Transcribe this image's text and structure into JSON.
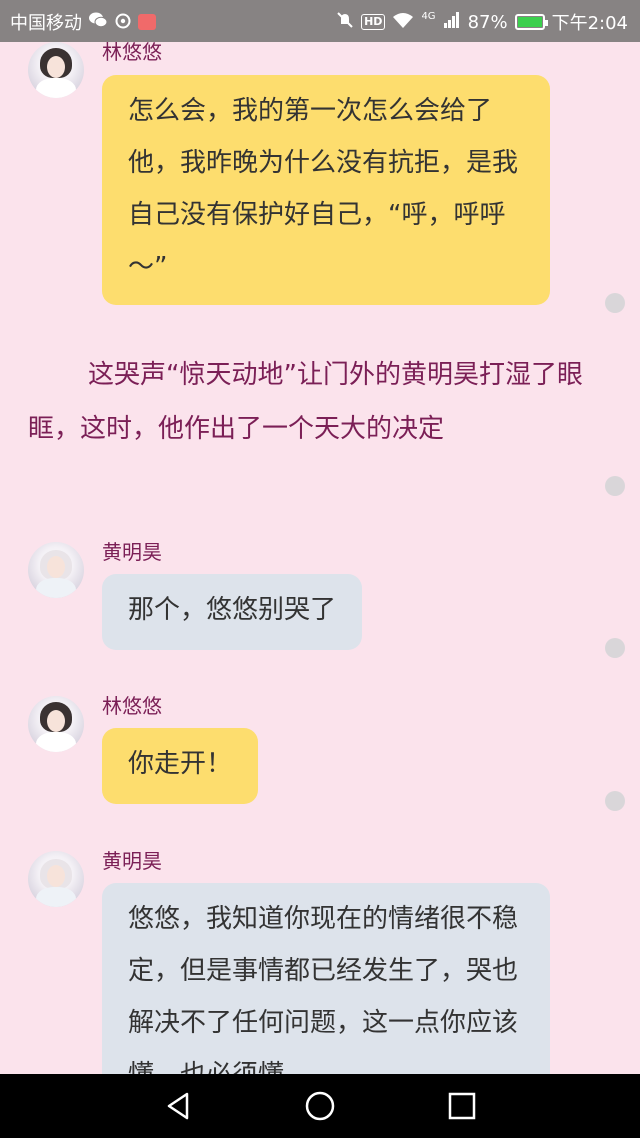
{
  "status_bar": {
    "carrier": "中国移动",
    "signal_type": "4G",
    "battery_percent": "87%",
    "time": "下午2:04",
    "hd_label": "HD",
    "icons": [
      "wechat-icon",
      "weibo-icon",
      "mail-icon",
      "mute-icon",
      "hd-icon",
      "wifi-icon",
      "signal-icon",
      "battery-icon"
    ]
  },
  "messages": [
    {
      "sender": "林悠悠",
      "type": "yellow",
      "text": "怎么会，我的第一次怎么会给了他，我昨晚为什么没有抗拒，是我自己没有保护好自己，“呼，呼呼～”"
    },
    {
      "narration": "这哭声“惊天动地”让门外的黄明昊打湿了眼眶，这时，他作出了一个天大的决定"
    },
    {
      "sender": "黄明昊",
      "type": "gray",
      "text": "那个，悠悠别哭了"
    },
    {
      "sender": "林悠悠",
      "type": "yellow",
      "text": "你走开！"
    },
    {
      "sender": "黄明昊",
      "type": "gray",
      "text": "悠悠，我知道你现在的情绪很不稳定，但是事情都已经发生了，哭也解决不了任何问题，这一点你应该懂，也必须懂"
    }
  ],
  "nav_bar": {
    "buttons": [
      "back-icon",
      "home-icon",
      "recents-icon"
    ]
  },
  "colors": {
    "background": "#fbe3ec",
    "status_bar": "#878383",
    "yellow_bubble": "#fddd6e",
    "gray_bubble": "#dde3eb",
    "name_text": "#7b1f56"
  }
}
